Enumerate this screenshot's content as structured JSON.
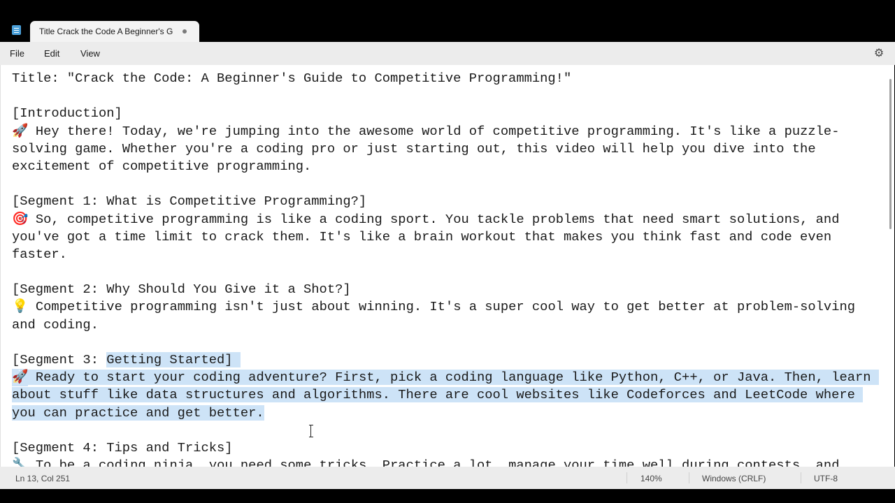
{
  "tab": {
    "title": "Title Crack the Code A Beginner's G"
  },
  "menu": {
    "file": "File",
    "edit": "Edit",
    "view": "View"
  },
  "icons": {
    "app": "notepad-icon",
    "settings": "gear-icon",
    "unsaved": "unsaved-dot"
  },
  "document": {
    "lines": [
      {
        "text": "Title: \"Crack the Code: A Beginner's Guide to Competitive Programming!\""
      },
      {
        "text": ""
      },
      {
        "text": "[Introduction]"
      },
      {
        "emoji": "🚀",
        "text": " Hey there! Today, we're jumping into the awesome world of competitive programming. It's like a puzzle-"
      },
      {
        "text": "solving game. Whether you're a coding pro or just starting out, this video will help you dive into the"
      },
      {
        "text": "excitement of competitive programming."
      },
      {
        "text": ""
      },
      {
        "text": "[Segment 1: What is Competitive Programming?]"
      },
      {
        "emoji": "🎯",
        "text": " So, competitive programming is like a coding sport. You tackle problems that need smart solutions, and"
      },
      {
        "text": "you've got a time limit to crack them. It's like a brain workout that makes you think fast and code even"
      },
      {
        "text": "faster."
      },
      {
        "text": ""
      },
      {
        "text": "[Segment 2: Why Should You Give it a Shot?]"
      },
      {
        "emoji": "💡",
        "text": " Competitive programming isn't just about winning. It's a super cool way to get better at problem-solving"
      },
      {
        "text": "and coding."
      },
      {
        "text": ""
      },
      {
        "text": "[Segment 3: ",
        "selected": "Getting Started] "
      },
      {
        "emoji": "🚀",
        "selected": " Ready to start your coding adventure? First, pick a coding language like Python, C++, or Java. Then, learn "
      },
      {
        "selected": "about stuff like data structures and algorithms. There are cool websites like Codeforces and LeetCode where "
      },
      {
        "selected": "you can practice and get better."
      },
      {
        "text": ""
      },
      {
        "text": "[Segment 4: Tips and Tricks]"
      },
      {
        "emoji": "🔧",
        "text": " To be a coding ninja, you need some tricks. Practice a lot, manage your time well during contests, and"
      }
    ]
  },
  "status": {
    "position": "Ln 13, Col 251",
    "zoom": "140%",
    "line_ending": "Windows (CRLF)",
    "encoding": "UTF-8"
  },
  "colors": {
    "selection": "#cde3f7",
    "chrome": "#ececec",
    "accent": "#4a9fd8"
  }
}
